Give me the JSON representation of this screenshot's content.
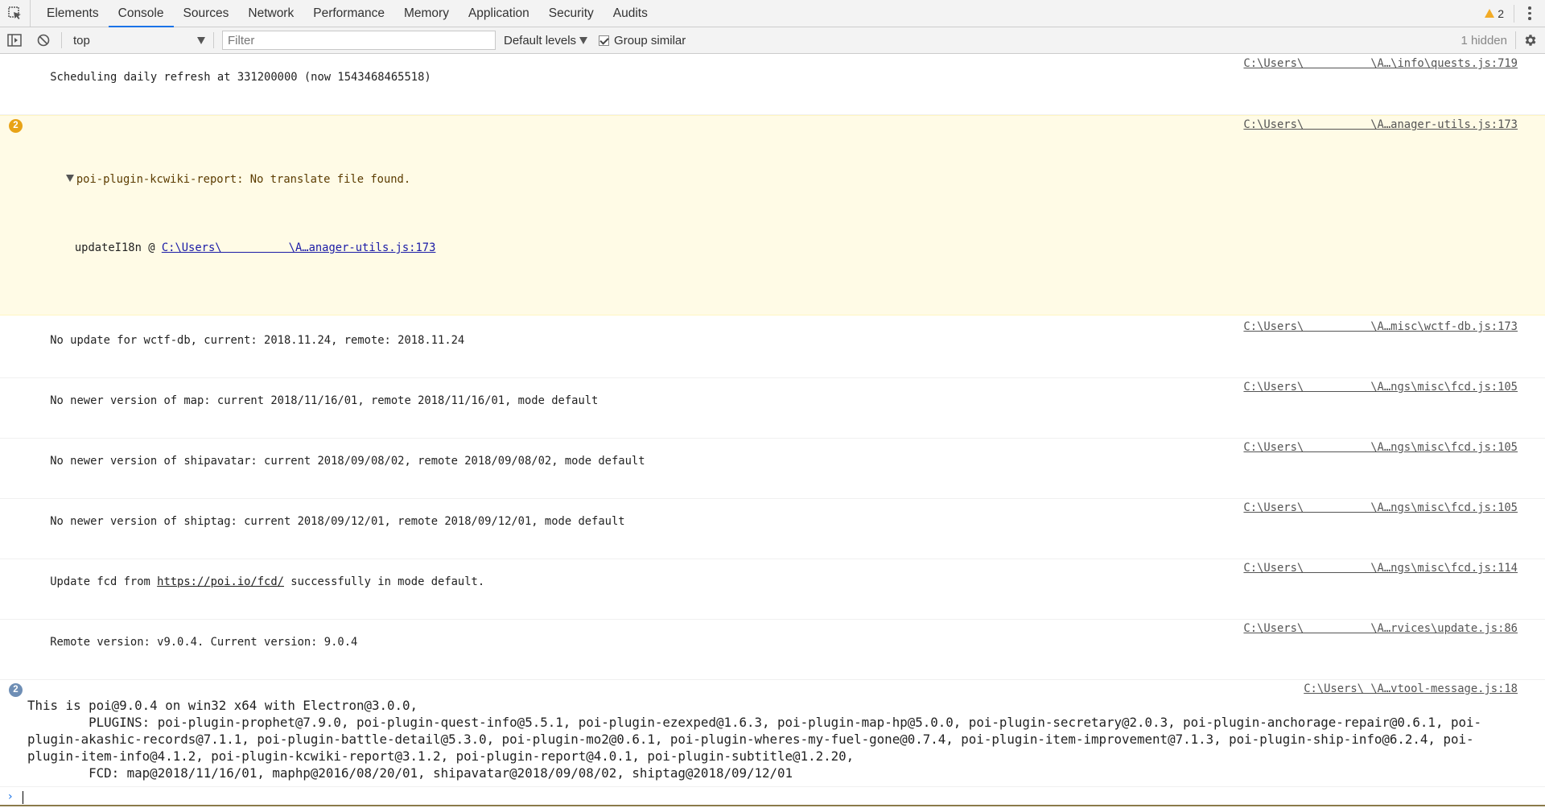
{
  "tabs": [
    "Elements",
    "Console",
    "Sources",
    "Network",
    "Performance",
    "Memory",
    "Application",
    "Security",
    "Audits"
  ],
  "active_tab": "Console",
  "warning_count": "2",
  "toolbar": {
    "context": "top",
    "filter_placeholder": "Filter",
    "levels": "Default levels",
    "group_similar": "Group similar",
    "hidden": "1 hidden"
  },
  "messages": {
    "m1": {
      "text": "Scheduling daily refresh at 331200000 (now 1543468465518)",
      "src": "C:\\Users\\          \\A…\\info\\quests.js:719"
    },
    "warn": {
      "count": "2",
      "text": "poi-plugin-kcwiki-report: No translate file found.",
      "src": "C:\\Users\\          \\A…anager-utils.js:173",
      "stack_fn": "updateI18n @ ",
      "stack_link": "C:\\Users\\          \\A…anager-utils.js:173"
    },
    "m3": {
      "text": "No update for wctf-db, current: 2018.11.24, remote: 2018.11.24",
      "src": "C:\\Users\\          \\A…misc\\wctf-db.js:173"
    },
    "m4": {
      "text": "No newer version of map: current 2018/11/16/01, remote 2018/11/16/01, mode default",
      "src": "C:\\Users\\          \\A…ngs\\misc\\fcd.js:105"
    },
    "m5": {
      "text": "No newer version of shipavatar: current 2018/09/08/02, remote 2018/09/08/02, mode default",
      "src": "C:\\Users\\          \\A…ngs\\misc\\fcd.js:105"
    },
    "m6": {
      "text": "No newer version of shiptag: current 2018/09/12/01, remote 2018/09/12/01, mode default",
      "src": "C:\\Users\\          \\A…ngs\\misc\\fcd.js:105"
    },
    "m7": {
      "pre": "Update fcd from ",
      "link": "https://poi.io/fcd/",
      "post": " successfully in mode default.",
      "src": "C:\\Users\\          \\A…ngs\\misc\\fcd.js:114"
    },
    "m8": {
      "text": "Remote version: v9.0.4. Current version: 9.0.4",
      "src": "C:\\Users\\          \\A…rvices\\update.js:86"
    },
    "info": {
      "count": "2",
      "src": "C:\\Users\\          \\A…vtool-message.js:18",
      "text": "This is poi@9.0.4 on win32 x64 with Electron@3.0.0,\n        PLUGINS: poi-plugin-prophet@7.9.0, poi-plugin-quest-info@5.5.1, poi-plugin-ezexped@1.6.3, poi-plugin-map-hp@5.0.0, poi-plugin-secretary@2.0.3, poi-plugin-anchorage-repair@0.6.1, poi-plugin-akashic-records@7.1.1, poi-plugin-battle-detail@5.3.0, poi-plugin-mo2@0.6.1, poi-plugin-wheres-my-fuel-gone@0.7.4, poi-plugin-item-improvement@7.1.3, poi-plugin-ship-info@6.2.4, poi-plugin-item-info@4.1.2, poi-plugin-kcwiki-report@3.1.2, poi-plugin-report@4.0.1, poi-plugin-subtitle@1.2.20,\n        FCD: map@2018/11/16/01, maphp@2016/08/20/01, shipavatar@2018/09/08/02, shiptag@2018/09/12/01"
    }
  },
  "colors": {
    "accent": "#1a73e8",
    "warning": "#e8a317",
    "info_badge": "#6e8eb5",
    "warning_bg": "#fffbe6"
  }
}
